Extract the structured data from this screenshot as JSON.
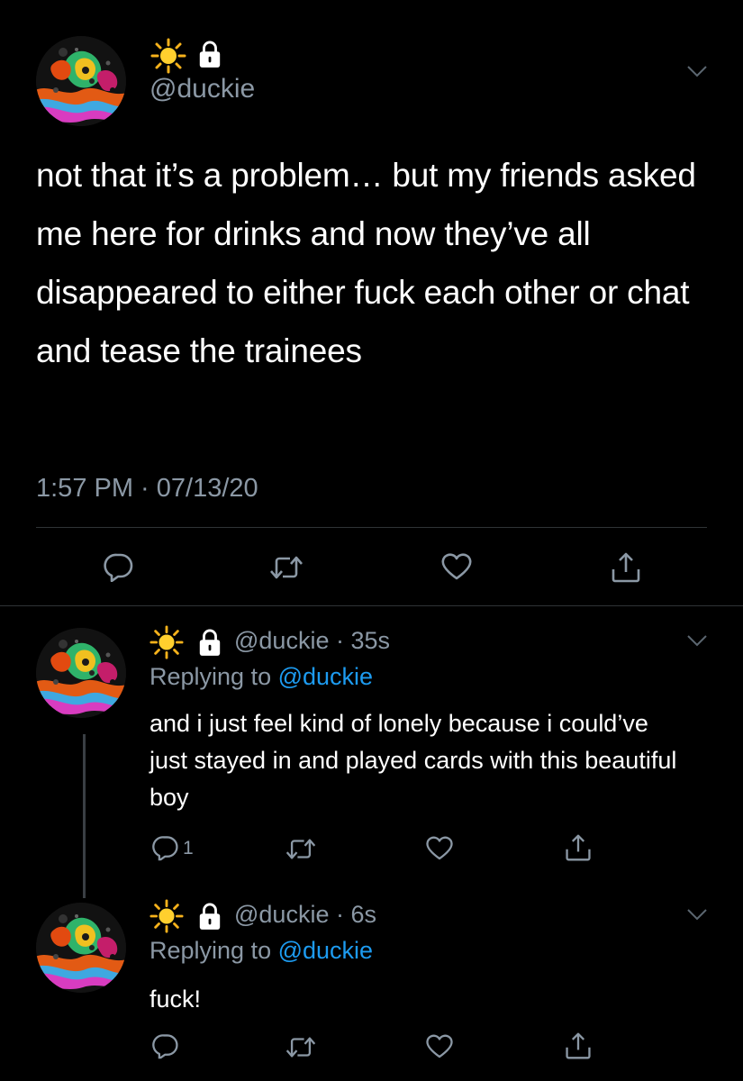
{
  "main_tweet": {
    "avatar_icon": "marbled-oil-avatar",
    "name_icons": [
      "sun-emoji-icon",
      "lock-icon"
    ],
    "handle": "@duckie",
    "text": "not that it’s a problem… but my friends asked me here for drinks and now they’ve all disappeared to either fuck each other or chat and tease the trainees",
    "timestamp": "1:57 PM · 07/13/20",
    "actions": [
      "reply-icon",
      "retweet-icon",
      "like-icon",
      "share-icon"
    ]
  },
  "replies": [
    {
      "handle_time": "@duckie · 35s",
      "replying_prefix": "Replying to ",
      "replying_handle": "@duckie",
      "text": "and i just feel kind of lonely because i could’ve just stayed in and played cards with this beautiful boy",
      "reply_count": "1"
    },
    {
      "handle_time": "@duckie · 6s",
      "replying_prefix": "Replying to ",
      "replying_handle": "@duckie",
      "text": "fuck!",
      "reply_count": ""
    }
  ],
  "colors": {
    "background": "#000000",
    "text": "#ffffff",
    "secondary": "#8b98a5",
    "link": "#1d9bf0",
    "divider": "#2f3336"
  }
}
